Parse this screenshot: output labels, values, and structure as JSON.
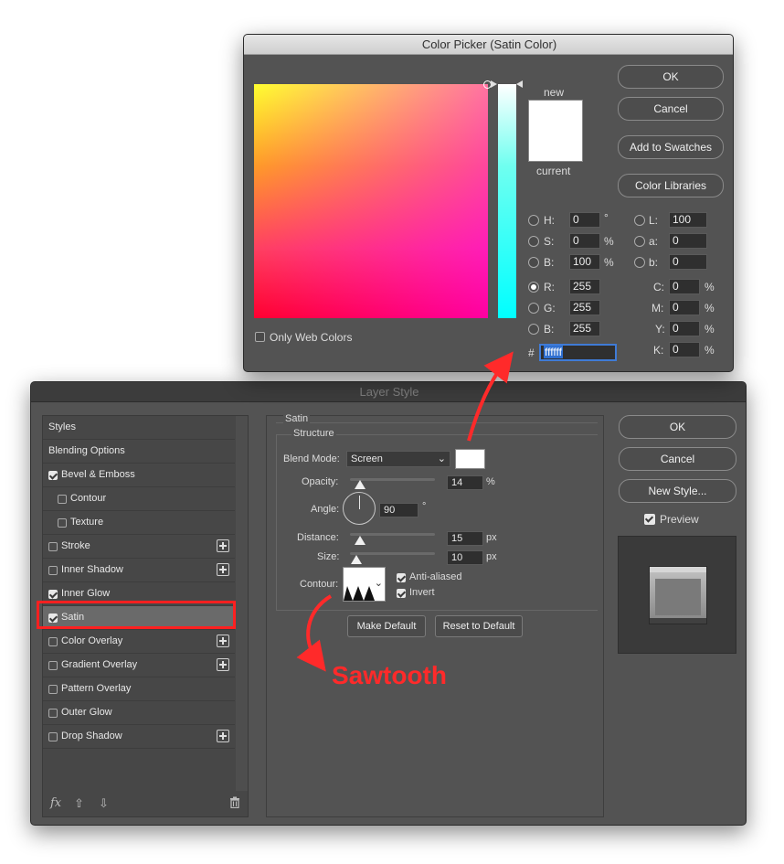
{
  "layer_style": {
    "title": "Layer Style",
    "sidebar": [
      {
        "label": "Styles",
        "checkbox": null,
        "plus": false,
        "indent": 0
      },
      {
        "label": "Blending Options",
        "checkbox": null,
        "plus": false,
        "indent": 0
      },
      {
        "label": "Bevel & Emboss",
        "checkbox": true,
        "plus": false,
        "indent": 0
      },
      {
        "label": "Contour",
        "checkbox": false,
        "plus": false,
        "indent": 1
      },
      {
        "label": "Texture",
        "checkbox": false,
        "plus": false,
        "indent": 1
      },
      {
        "label": "Stroke",
        "checkbox": false,
        "plus": true,
        "indent": 0
      },
      {
        "label": "Inner Shadow",
        "checkbox": false,
        "plus": true,
        "indent": 0
      },
      {
        "label": "Inner Glow",
        "checkbox": true,
        "plus": false,
        "indent": 0
      },
      {
        "label": "Satin",
        "checkbox": true,
        "plus": false,
        "indent": 0,
        "selected": true
      },
      {
        "label": "Color Overlay",
        "checkbox": false,
        "plus": true,
        "indent": 0
      },
      {
        "label": "Gradient Overlay",
        "checkbox": false,
        "plus": true,
        "indent": 0
      },
      {
        "label": "Pattern Overlay",
        "checkbox": false,
        "plus": false,
        "indent": 0
      },
      {
        "label": "Outer Glow",
        "checkbox": false,
        "plus": false,
        "indent": 0
      },
      {
        "label": "Drop Shadow",
        "checkbox": false,
        "plus": true,
        "indent": 0
      }
    ],
    "bottom_icons": {
      "fx": "fx",
      "up": "arrow-up-icon",
      "down": "arrow-down-icon",
      "trash": "trash-icon"
    },
    "satin": {
      "group_title": "Satin",
      "structure_title": "Structure",
      "blend_mode_label": "Blend Mode:",
      "blend_mode_value": "Screen",
      "blend_color": "#ffffff",
      "opacity_label": "Opacity:",
      "opacity_value": "14",
      "opacity_unit": "%",
      "angle_label": "Angle:",
      "angle_value": "90",
      "angle_unit": "°",
      "distance_label": "Distance:",
      "distance_value": "15",
      "distance_unit": "px",
      "size_label": "Size:",
      "size_value": "10",
      "size_unit": "px",
      "contour_label": "Contour:",
      "anti_aliased_label": "Anti-aliased",
      "anti_aliased": true,
      "invert_label": "Invert",
      "invert": true,
      "make_default": "Make Default",
      "reset_default": "Reset to Default"
    },
    "buttons": {
      "ok": "OK",
      "cancel": "Cancel",
      "new_style": "New Style..."
    },
    "preview_label": "Preview",
    "preview_checked": true
  },
  "color_picker": {
    "title": "Color Picker (Satin Color)",
    "new_label": "new",
    "current_label": "current",
    "only_web_colors": "Only Web Colors",
    "buttons": {
      "ok": "OK",
      "cancel": "Cancel",
      "add_swatches": "Add to Swatches",
      "color_libraries": "Color Libraries"
    },
    "hsb": {
      "h_label": "H:",
      "h": "0",
      "h_unit": "°",
      "s_label": "S:",
      "s": "0",
      "s_unit": "%",
      "b_label": "B:",
      "b": "100",
      "b_unit": "%"
    },
    "rgb": {
      "r_label": "R:",
      "r": "255",
      "g_label": "G:",
      "g": "255",
      "b_label": "B:",
      "b": "255"
    },
    "lab": {
      "l_label": "L:",
      "l": "100",
      "a_label": "a:",
      "a": "0",
      "b_label": "b:",
      "b": "0"
    },
    "cmyk": {
      "c_label": "C:",
      "c": "0",
      "m_label": "M:",
      "m": "0",
      "y_label": "Y:",
      "y": "0",
      "k_label": "K:",
      "k": "0",
      "unit": "%"
    },
    "hex_label": "#",
    "hex": "ffffff"
  },
  "annotation": {
    "sawtooth_label": "Sawtooth",
    "color": "#ff2a2a"
  }
}
